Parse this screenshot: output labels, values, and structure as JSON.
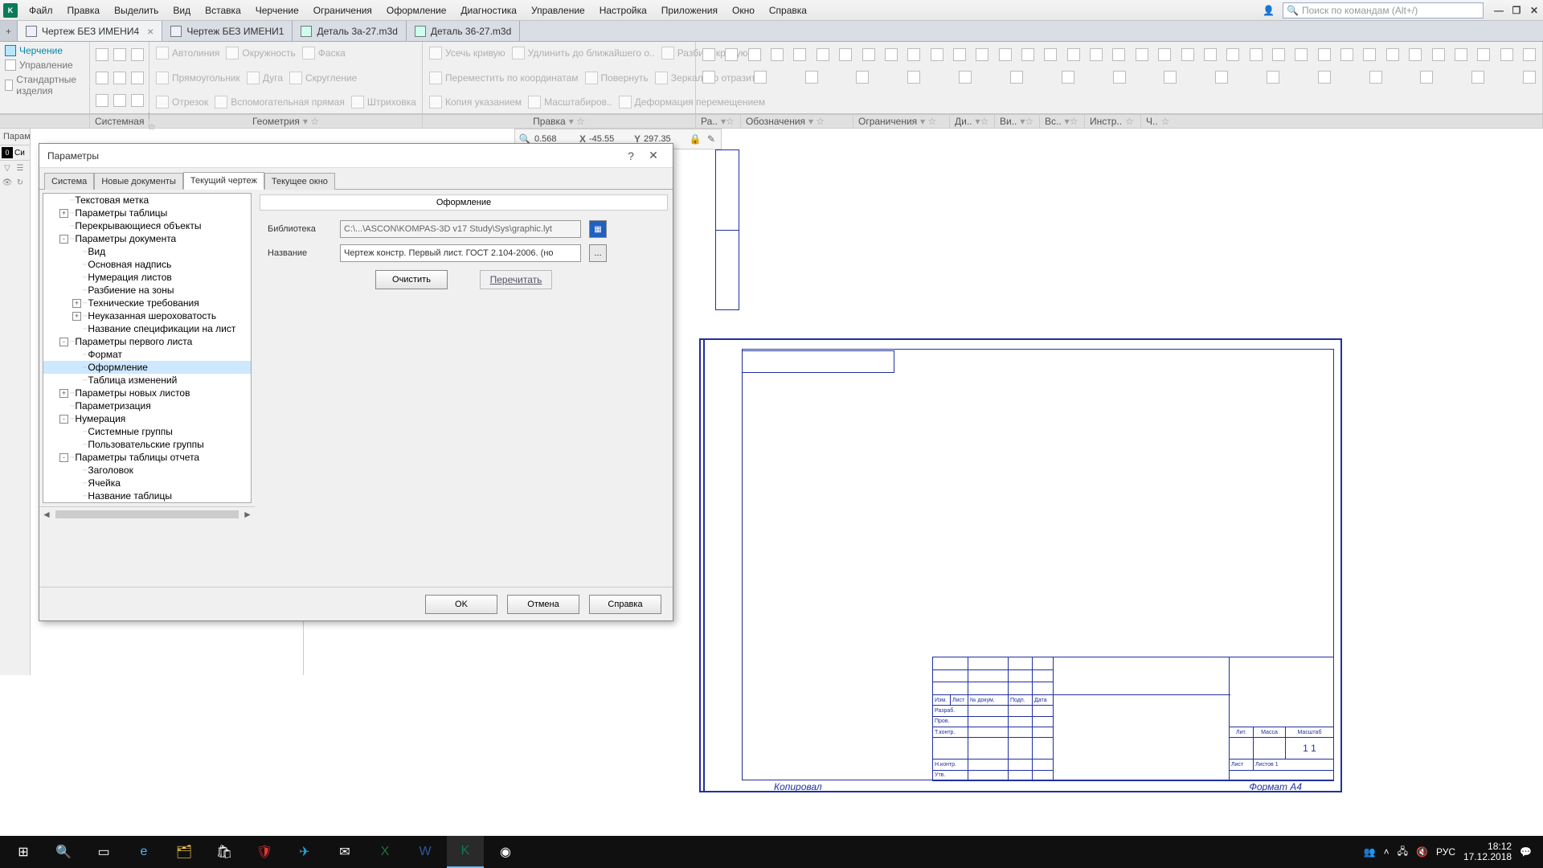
{
  "menu": [
    "Файл",
    "Правка",
    "Выделить",
    "Вид",
    "Вставка",
    "Черчение",
    "Ограничения",
    "Оформление",
    "Диагностика",
    "Управление",
    "Настройка",
    "Приложения",
    "Окно",
    "Справка"
  ],
  "search_placeholder": "Поиск по командам (Alt+/)",
  "doctabs": [
    {
      "label": "Чертеж БЕЗ ИМЕНИ4",
      "active": true,
      "close": true
    },
    {
      "label": "Чертеж БЕЗ ИМЕНИ1",
      "active": false,
      "close": false
    },
    {
      "label": "Деталь 3а-27.m3d",
      "active": false,
      "close": false
    },
    {
      "label": "Деталь 36-27.m3d",
      "active": false,
      "close": false
    }
  ],
  "modes": [
    {
      "label": "Черчение",
      "active": true
    },
    {
      "label": "Управление",
      "active": false
    },
    {
      "label": "Стандартные изделия",
      "active": false
    }
  ],
  "ribbon_tools": {
    "geom": [
      [
        "Автолиния",
        "Окружность",
        "Фаска"
      ],
      [
        "Прямоугольник",
        "Дуга",
        "Скругление"
      ],
      [
        "Отрезок",
        "Вспомогатель­ная прямая",
        "Штриховка"
      ]
    ],
    "edit": [
      [
        "Усечь кривую",
        "Удлинить до ближайшего о..",
        "Разбить кривую"
      ],
      [
        "Переместить по координатам",
        "Повернуть",
        "Зеркально отразить"
      ],
      [
        "Копия указанием",
        "Масштабиров..",
        "Деформация перемещением"
      ]
    ]
  },
  "groups": [
    "Системная",
    "Геометрия",
    "Правка",
    "Ра..",
    "Обозначения",
    "Ограничения",
    "Ди..",
    "Ви..",
    "Вс..",
    "Инстр..",
    "Ч.."
  ],
  "coord": {
    "zoom": "0.568",
    "x": "-45.55",
    "y": "297.35",
    "xl": "X",
    "yl": "Y"
  },
  "leftpanel": {
    "title": "Парам",
    "zero": "0",
    "c": "Си"
  },
  "dialog": {
    "title": "Параметры",
    "tabs": [
      "Система",
      "Новые документы",
      "Текущий чертеж",
      "Текущее окно"
    ],
    "active_tab": 2,
    "tree": [
      {
        "d": 1,
        "exp": "",
        "t": "Текстовая метка"
      },
      {
        "d": 1,
        "exp": "+",
        "t": "Параметры таблицы"
      },
      {
        "d": 1,
        "exp": "",
        "t": "Перекрывающиеся объекты"
      },
      {
        "d": 1,
        "exp": "-",
        "t": "Параметры документа"
      },
      {
        "d": 2,
        "exp": "",
        "t": "Вид"
      },
      {
        "d": 2,
        "exp": "",
        "t": "Основная надпись"
      },
      {
        "d": 2,
        "exp": "",
        "t": "Нумерация листов"
      },
      {
        "d": 2,
        "exp": "",
        "t": "Разбиение на зоны"
      },
      {
        "d": 2,
        "exp": "+",
        "t": "Технические требования"
      },
      {
        "d": 2,
        "exp": "+",
        "t": "Неуказанная шероховатость"
      },
      {
        "d": 2,
        "exp": "",
        "t": "Название спецификации на лист"
      },
      {
        "d": 1,
        "exp": "-",
        "t": "Параметры первого листа"
      },
      {
        "d": 2,
        "exp": "",
        "t": "Формат"
      },
      {
        "d": 2,
        "exp": "",
        "t": "Оформление",
        "sel": true
      },
      {
        "d": 2,
        "exp": "",
        "t": "Таблица изменений"
      },
      {
        "d": 1,
        "exp": "+",
        "t": "Параметры новых листов"
      },
      {
        "d": 1,
        "exp": "",
        "t": "Параметризация"
      },
      {
        "d": 1,
        "exp": "-",
        "t": "Нумерация"
      },
      {
        "d": 2,
        "exp": "",
        "t": "Системные группы"
      },
      {
        "d": 2,
        "exp": "",
        "t": "Пользовательские группы"
      },
      {
        "d": 1,
        "exp": "-",
        "t": "Параметры таблицы отчета"
      },
      {
        "d": 2,
        "exp": "",
        "t": "Заголовок"
      },
      {
        "d": 2,
        "exp": "",
        "t": "Ячейка"
      },
      {
        "d": 2,
        "exp": "",
        "t": "Название таблицы"
      }
    ],
    "content_header": "Оформление",
    "lib_label": "Библиотека",
    "lib_value": "C:\\...\\ASCON\\KOMPAS-3D v17 Study\\Sys\\graphic.lyt",
    "name_label": "Название",
    "name_value": "Чертеж констр. Первый лист. ГОСТ 2.104-2006. (но",
    "clear": "Очистить",
    "reread": "Перечитать",
    "ok": "OK",
    "cancel": "Отмена",
    "help": "Справка"
  },
  "titleblock": {
    "rows": [
      "Изм",
      "Разраб.",
      "Пров.",
      "Т.контр.",
      "",
      "Н.контр.",
      "Утв."
    ],
    "hdr": [
      "Лит.",
      "Масса",
      "Масштаб"
    ],
    "num": "1 1",
    "foot1": "Лист",
    "foot2": "Листов   1",
    "bottom_l": "Копировал",
    "bottom_r": "Формат    A4",
    "col_hdr": [
      "Изм.",
      "Лист",
      "№ докум.",
      "Подп.",
      "Дата"
    ]
  },
  "tray": {
    "lang": "РУС",
    "time": "18:12",
    "date": "17.12.2018"
  }
}
